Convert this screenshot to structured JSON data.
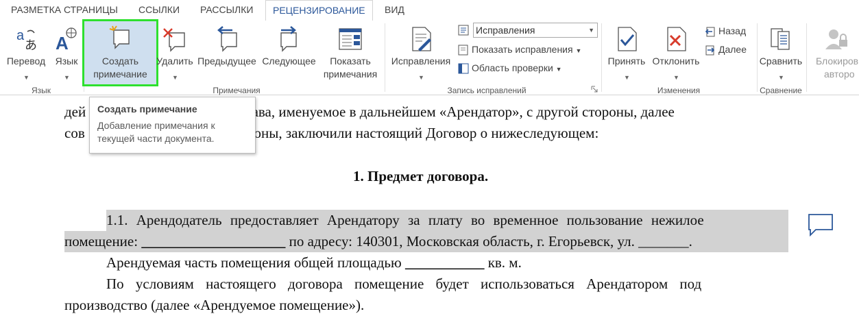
{
  "tabs": [
    "РАЗМЕТКА СТРАНИЦЫ",
    "ССЫЛКИ",
    "РАССЫЛКИ",
    "РЕЦЕНЗИРОВАНИЕ",
    "ВИД"
  ],
  "active_tab": "РЕЦЕНЗИРОВАНИЕ",
  "ribbon": {
    "translate": "Перевод",
    "language": "Язык",
    "new_comment_1": "Создать",
    "new_comment_2": "примечание",
    "delete": "Удалить",
    "previous": "Предыдущее",
    "next": "Следующее",
    "show_comments_1": "Показать",
    "show_comments_2": "примечания",
    "track_changes": "Исправления",
    "markup_select": "Исправления",
    "show_markup": "Показать исправления",
    "reviewing_pane": "Область проверки",
    "accept": "Принять",
    "reject": "Отклонить",
    "back": "Назад",
    "forward": "Далее",
    "compare": "Сравнить",
    "block_authors_1": "Блокиров",
    "block_authors_2": "авторо"
  },
  "groups": {
    "language": "Язык",
    "comments": "Примечания",
    "tracking": "Запись исправлений",
    "changes": "Изменения",
    "compare": "Сравнение"
  },
  "tooltip": {
    "title": "Создать примечание",
    "line1": "Добавление примечания к",
    "line2": "текущей части документа."
  },
  "document": {
    "line1_a": "дей",
    "line1_b": "и Устава, именуемое в дальнейшем «Арендатор», с другой стороны, далее",
    "line2_a": "сов",
    "line2_b": "роны, заключили настоящий Договор о нижеследующем:",
    "heading": "1. Предмет договора.",
    "p1_line1": "1.1. Арендодатель предоставляет Арендатору за плату во временное пользование нежилое",
    "p1_line2_a": "помещение: ",
    "p1_blank": "____________________",
    "p1_line2_b": " по адресу: 140301, Московская область, г. Егорьевск, ул. _______.",
    "p2_a": "Арендуемая часть помещения общей площадью ",
    "p2_blank": "___________",
    "p2_b": " кв. м.",
    "p3_line1": "По условиям настоящего договора помещение будет использоваться Арендатором под",
    "p3_line2": "производство (далее «Арендуемое помещение»)."
  },
  "colors": {
    "accent": "#2b579a",
    "highlight_outline": "#2ee02e",
    "selection": "#d2d2d2"
  }
}
